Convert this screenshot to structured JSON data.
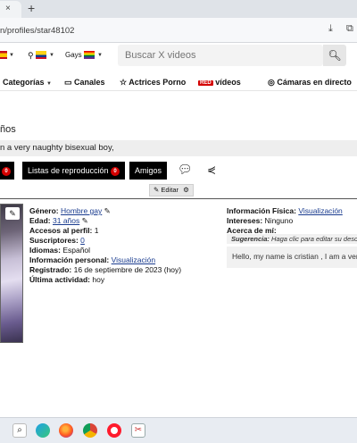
{
  "browser": {
    "url": "n/profiles/star48102",
    "new_tab": "+",
    "close_tab": "×"
  },
  "header": {
    "gays_label": "Gays",
    "search_placeholder": "Buscar X videos"
  },
  "nav": {
    "categorias": "Categorías",
    "canales": "Canales",
    "actrices": "Actrices Porno",
    "red_badge": "RED",
    "red_videos": "vídeos",
    "camaras": "Cámaras en directo"
  },
  "profile": {
    "name_fragment": "ños",
    "bio_fragment": "n a very naughty bisexual boy,",
    "tabs": {
      "first_count": "0",
      "playlists": "Listas de reproducción",
      "playlists_count": "0",
      "friends": "Amigos"
    },
    "edit_label": "Editar",
    "left": [
      {
        "label": "Género:",
        "value": "Hombre gay",
        "link": true
      },
      {
        "label": "Edad:",
        "value": "31 años",
        "link": true
      },
      {
        "label": "Accesos al perfil:",
        "value": "1",
        "link": false
      },
      {
        "label": "Suscriptores:",
        "value": "0",
        "link": true
      },
      {
        "label": "Idiomas:",
        "value": "Español",
        "link": false
      },
      {
        "label": "Información personal:",
        "value": "Visualización",
        "link": true
      },
      {
        "label": "Registrado:",
        "value": "16 de septiembre de 2023 (hoy)",
        "link": false
      },
      {
        "label": "Última actividad:",
        "value": "hoy",
        "link": false
      }
    ],
    "right": {
      "physical_label": "Información Física:",
      "physical_value": "Visualización",
      "interests_label": "Intereses:",
      "interests_value": "Ninguno",
      "about_label": "Acerca de mí:",
      "suggestion_label": "Sugerencia:",
      "suggestion_text": "Haga clic para editar su desc",
      "about_text": "Hello, my name is cristian , I am a very"
    }
  },
  "colors": {
    "accent_red": "#d40000",
    "link_blue": "#1a3c8f",
    "tab_black": "#000000"
  }
}
